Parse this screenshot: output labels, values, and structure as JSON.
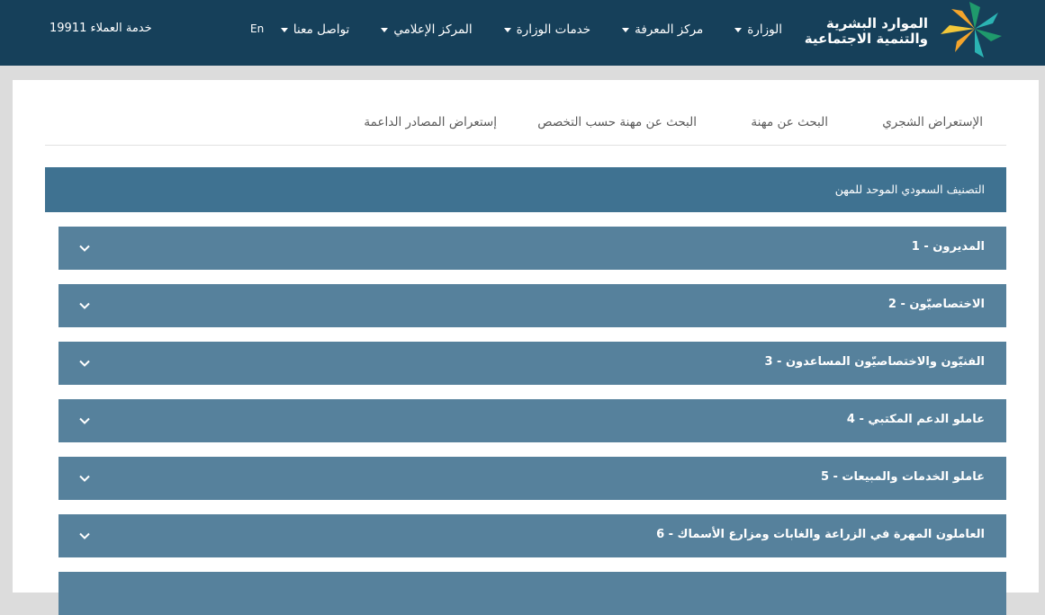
{
  "brand": {
    "line1": "الموارد البشرية",
    "line2": "والتنمية الاجتماعية",
    "colors": {
      "green": "#1f9a6c",
      "orange": "#f3a42b",
      "teal": "#2bb3b3",
      "yellow": "#f2c83a"
    }
  },
  "nav": {
    "items": [
      {
        "label": "الوزارة"
      },
      {
        "label": "مركز المعرفة"
      },
      {
        "label": "خدمات الوزارة"
      },
      {
        "label": "المركز الإعلامي"
      },
      {
        "label": "تواصل معنا"
      }
    ],
    "lang": "En",
    "hotline": "خدمة العملاء 19911"
  },
  "tabs": [
    "الإستعراض الشجري",
    "البحث عن مهنة",
    "البحث عن مهنة حسب التخصص",
    "إستعراض المصادر الداعمة"
  ],
  "section_title": "التصنيف السعودي الموحد للمهن",
  "groups": [
    {
      "label": "المديرون  -  1"
    },
    {
      "label": "الاختصاصيّون  -  2"
    },
    {
      "label": "الفنيّون والاختصاصيّون المساعدون  -  3"
    },
    {
      "label": "عاملو الدعم المكتبي  -  4"
    },
    {
      "label": "عاملو الخدمات والمبيعات  -  5"
    },
    {
      "label": "العاملون المهرة في الزراعة والغابات ومزارع الأسماك  -  6"
    },
    {
      "label": ""
    }
  ],
  "colors": {
    "topbar": "#16405a",
    "section_header": "#3f7291",
    "accordion_row": "#56819c"
  }
}
